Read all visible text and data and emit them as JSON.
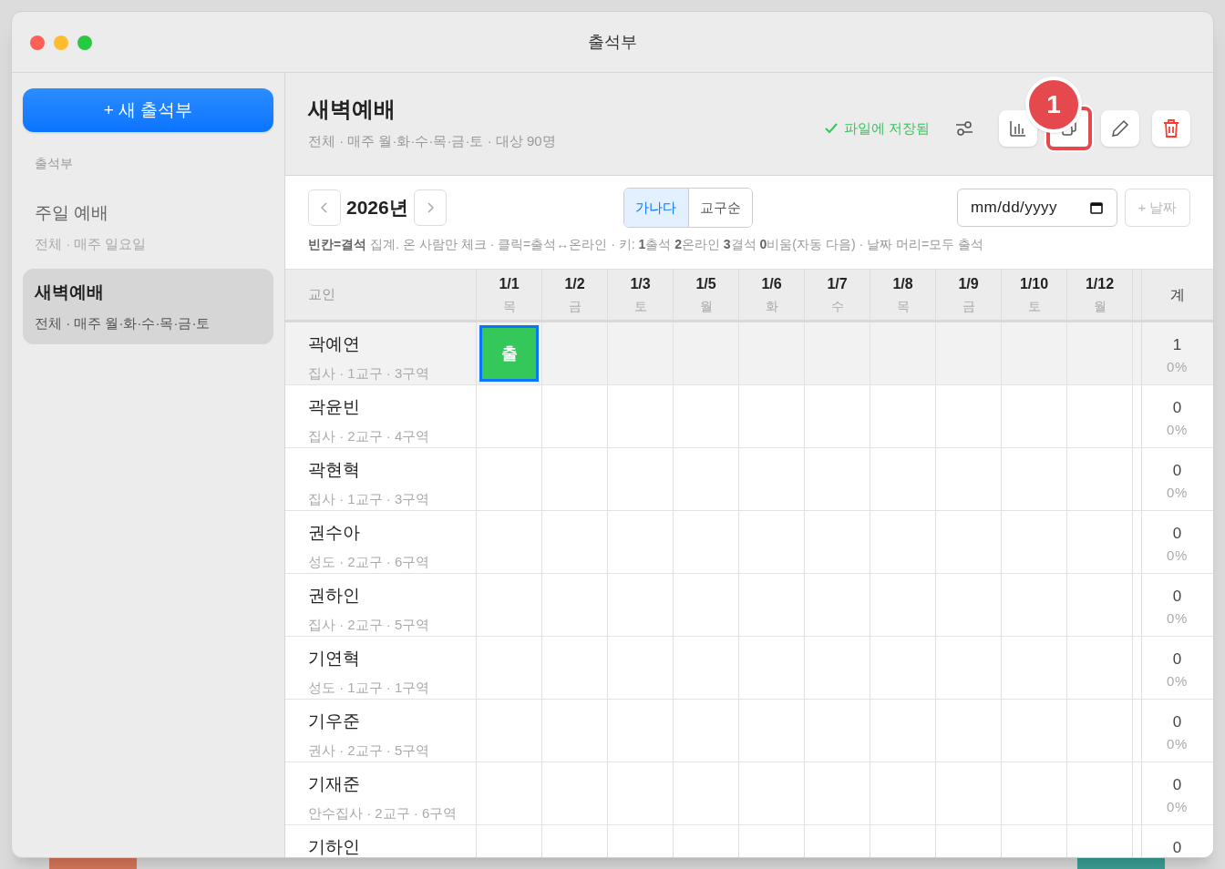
{
  "window": {
    "title": "출석부"
  },
  "sidebar": {
    "new_button": "+ 새 출석부",
    "section": "출석부",
    "items": [
      {
        "title": "주일 예배",
        "subtitle": "전체 · 매주 일요일",
        "selected": false
      },
      {
        "title": "새벽예배",
        "subtitle": "전체 · 매주 월·화·수·목·금·토",
        "selected": true
      }
    ]
  },
  "header": {
    "title": "새벽예배",
    "subtitle": "전체 · 매주 월·화·수·목·금·토 · 대상 90명",
    "save_status": "파일에 저장됨",
    "annotation_badge": "1"
  },
  "toolbar": {
    "year": "2026년",
    "sort_options": [
      {
        "label": "가나다",
        "selected": true
      },
      {
        "label": "교구순",
        "selected": false
      }
    ],
    "date_placeholder": "mm/dd/yyyy",
    "add_date_button": "+ 날짜",
    "help": "**빈칸=결석** 집계. 온 사람만 체크 · 클릭=출석↔온라인 · 키: **1**출석 **2**온라인 **3**결석 **0**비움(자동 다음) · 날짜 머리=모두 출석"
  },
  "table": {
    "name_column": "교인",
    "total_column": "계",
    "dates": [
      {
        "date": "1/1",
        "day": "목"
      },
      {
        "date": "1/2",
        "day": "금"
      },
      {
        "date": "1/3",
        "day": "토"
      },
      {
        "date": "1/5",
        "day": "월"
      },
      {
        "date": "1/6",
        "day": "화"
      },
      {
        "date": "1/7",
        "day": "수"
      },
      {
        "date": "1/8",
        "day": "목"
      },
      {
        "date": "1/9",
        "day": "금"
      },
      {
        "date": "1/10",
        "day": "토"
      },
      {
        "date": "1/12",
        "day": "월"
      }
    ],
    "rows": [
      {
        "name": "곽예연",
        "meta": "집사 · 1교구 · 3구역",
        "selected": true,
        "total": "1",
        "percent": "0%",
        "cells": [
          {
            "kind": "present",
            "label": "출",
            "focused": true
          },
          {
            "kind": "empty"
          },
          {
            "kind": "empty"
          },
          {
            "kind": "empty"
          },
          {
            "kind": "empty"
          },
          {
            "kind": "empty"
          },
          {
            "kind": "empty"
          },
          {
            "kind": "empty"
          },
          {
            "kind": "empty"
          },
          {
            "kind": "empty"
          }
        ]
      },
      {
        "name": "곽윤빈",
        "meta": "집사 · 2교구 · 4구역",
        "selected": false,
        "total": "0",
        "percent": "0%"
      },
      {
        "name": "곽현혁",
        "meta": "집사 · 1교구 · 3구역",
        "selected": false,
        "total": "0",
        "percent": "0%"
      },
      {
        "name": "권수아",
        "meta": "성도 · 2교구 · 6구역",
        "selected": false,
        "total": "0",
        "percent": "0%"
      },
      {
        "name": "권하인",
        "meta": "집사 · 2교구 · 5구역",
        "selected": false,
        "total": "0",
        "percent": "0%"
      },
      {
        "name": "기연혁",
        "meta": "성도 · 1교구 · 1구역",
        "selected": false,
        "total": "0",
        "percent": "0%"
      },
      {
        "name": "기우준",
        "meta": "권사 · 2교구 · 5구역",
        "selected": false,
        "total": "0",
        "percent": "0%"
      },
      {
        "name": "기재준",
        "meta": "안수집사 · 2교구 · 6구역",
        "selected": false,
        "total": "0",
        "percent": "0%"
      },
      {
        "name": "기하인",
        "selected": false,
        "total": "0"
      }
    ]
  }
}
